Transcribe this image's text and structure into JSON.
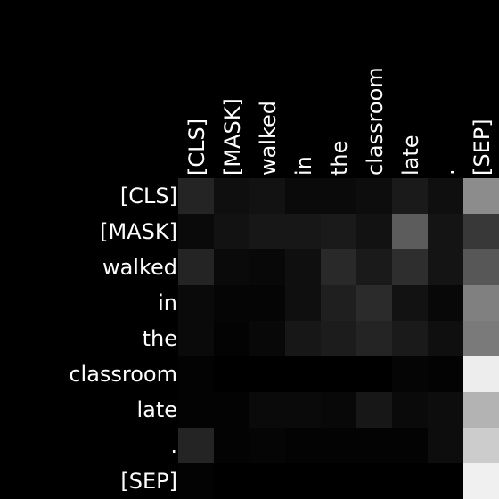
{
  "chart_data": {
    "type": "heatmap",
    "x_labels": [
      "[CLS]",
      "[MASK]",
      "walked",
      "in",
      "the",
      "classroom",
      "late",
      ".",
      "[SEP]"
    ],
    "y_labels": [
      "[CLS]",
      "[MASK]",
      "walked",
      "in",
      "the",
      "classroom",
      "late",
      ".",
      "[SEP]"
    ],
    "colormap": "grayscale",
    "value_range": [
      0,
      1
    ],
    "values": [
      [
        0.14,
        0.06,
        0.07,
        0.04,
        0.04,
        0.05,
        0.1,
        0.06,
        0.55
      ],
      [
        0.04,
        0.07,
        0.09,
        0.09,
        0.1,
        0.07,
        0.36,
        0.08,
        0.22
      ],
      [
        0.14,
        0.04,
        0.03,
        0.06,
        0.16,
        0.1,
        0.18,
        0.08,
        0.34
      ],
      [
        0.04,
        0.02,
        0.02,
        0.06,
        0.12,
        0.17,
        0.07,
        0.03,
        0.5
      ],
      [
        0.04,
        0.01,
        0.03,
        0.09,
        0.11,
        0.14,
        0.1,
        0.06,
        0.48
      ],
      [
        0.01,
        0.0,
        0.0,
        0.0,
        0.0,
        0.0,
        0.02,
        0.01,
        0.93
      ],
      [
        0.01,
        0.01,
        0.04,
        0.04,
        0.03,
        0.09,
        0.04,
        0.05,
        0.7
      ],
      [
        0.14,
        0.01,
        0.02,
        0.01,
        0.01,
        0.01,
        0.01,
        0.05,
        0.8
      ],
      [
        0.01,
        0.0,
        0.0,
        0.0,
        0.0,
        0.0,
        0.0,
        0.0,
        0.94
      ]
    ]
  },
  "colors": {
    "background": "#000000",
    "label": "#ffffff"
  }
}
